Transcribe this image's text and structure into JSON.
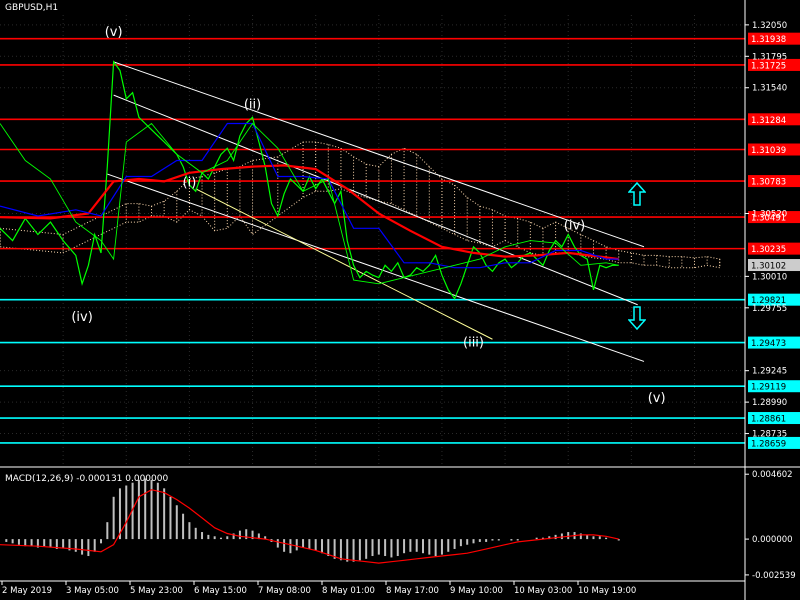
{
  "header": {
    "symbol": "GBPUSD,H1",
    "macd_label": "MACD(12,26,9) -0.000131 0.000000"
  },
  "colors": {
    "background": "#000000",
    "price_line": "#00ff00",
    "ma_red": "#ff0000",
    "ma_blue": "#0000ff",
    "resistance": "#ff0000",
    "support": "#00ffff",
    "channel": "#ffffff",
    "channel_yellow": "#ffff99",
    "cloud": "#ffdab0",
    "macd_hist": "#c0c0c0",
    "signal": "#ff0000",
    "arrows": "#00ffff",
    "current_price_box": "#cccccc"
  },
  "icons": {
    "up": "up-arrow-icon",
    "down": "down-arrow-icon"
  },
  "chart_data": {
    "type": "line",
    "title": "GBPUSD,H1",
    "ylim": [
      1.2848,
      1.3213
    ],
    "y_ticks": [
      "1.32050",
      "1.31795",
      "1.31540",
      "1.30520",
      "1.30010",
      "1.29755",
      "1.29245",
      "1.28990",
      "1.28735"
    ],
    "x_ticks": [
      "2 May 2019",
      "3 May 05:00",
      "5 May 23:00",
      "6 May 15:00",
      "7 May 08:00",
      "8 May 01:00",
      "8 May 17:00",
      "9 May 10:00",
      "10 May 03:00",
      "10 May 19:00"
    ],
    "current_price": "1.30102",
    "resistance_levels": [
      {
        "value": 1.31938,
        "label": "1.31938"
      },
      {
        "value": 1.31725,
        "label": "1.31725"
      },
      {
        "value": 1.31284,
        "label": "1.31284"
      },
      {
        "value": 1.31039,
        "label": "1.31039"
      },
      {
        "value": 1.30783,
        "label": "1.30783"
      },
      {
        "value": 1.30491,
        "label": "1.30491"
      },
      {
        "value": 1.30235,
        "label": "1.30235"
      }
    ],
    "support_levels": [
      {
        "value": 1.29821,
        "label": "1.29821"
      },
      {
        "value": 1.29473,
        "label": "1.29473"
      },
      {
        "value": 1.29119,
        "label": "1.29119"
      },
      {
        "value": 1.28861,
        "label": "1.28861"
      },
      {
        "value": 1.28659,
        "label": "1.28659"
      }
    ],
    "wave_labels": [
      {
        "label": "(v)",
        "x": 18,
        "y": 1.3196
      },
      {
        "label": "(iv)",
        "x": 13,
        "y": 1.2965
      },
      {
        "label": "(ii)",
        "x": 40,
        "y": 1.3137
      },
      {
        "label": "(i)",
        "x": 30,
        "y": 1.3074
      },
      {
        "label": "(iii)",
        "x": 75,
        "y": 1.2944
      },
      {
        "label": "(iv)",
        "x": 91,
        "y": 1.3039
      },
      {
        "label": "(v)",
        "x": 104,
        "y": 1.2899
      }
    ],
    "channels": [
      {
        "color": "white",
        "points": [
          [
            18,
            1.3175
          ],
          [
            102,
            1.3025
          ]
        ]
      },
      {
        "color": "white",
        "points": [
          [
            18,
            1.3148
          ],
          [
            101,
            1.2978
          ]
        ]
      },
      {
        "color": "white",
        "points": [
          [
            17,
            1.3084
          ],
          [
            102,
            1.2932
          ]
        ]
      },
      {
        "color": "yellow",
        "points": [
          [
            31,
            1.3072
          ],
          [
            78,
            1.295
          ]
        ]
      }
    ],
    "series": [
      {
        "name": "",
        "x": [
          0,
          2,
          4,
          6,
          8,
          10,
          12,
          13,
          14,
          15,
          16,
          17,
          18,
          19,
          20,
          21,
          22,
          23,
          24,
          25,
          26,
          27,
          28,
          29,
          30,
          31,
          32,
          33,
          34,
          35,
          36,
          37,
          38,
          39,
          40,
          41,
          42,
          43,
          44,
          45,
          46,
          47,
          48,
          49,
          50,
          51,
          52,
          53,
          54,
          55,
          56,
          57,
          58,
          59,
          60,
          61,
          62,
          63,
          64,
          65,
          66,
          67,
          68,
          69,
          70,
          71,
          72,
          73,
          74,
          75,
          76,
          77,
          78,
          79,
          80,
          81,
          82,
          83,
          84,
          85,
          86,
          87,
          88,
          89,
          90,
          91,
          92,
          93,
          94,
          95,
          96,
          97,
          98
        ],
        "y": [
          1.304,
          1.303,
          1.3048,
          1.3035,
          1.3045,
          1.303,
          1.3018,
          1.2995,
          1.301,
          1.3035,
          1.302,
          1.309,
          1.3175,
          1.3168,
          1.3145,
          1.315,
          1.313,
          1.3125,
          1.312,
          1.3115,
          1.311,
          1.3105,
          1.31,
          1.309,
          1.3075,
          1.307,
          1.3085,
          1.308,
          1.309,
          1.31,
          1.3105,
          1.3095,
          1.3115,
          1.3125,
          1.313,
          1.311,
          1.309,
          1.306,
          1.305,
          1.3068,
          1.308,
          1.3075,
          1.307,
          1.3082,
          1.3072,
          1.308,
          1.307,
          1.306,
          1.307,
          1.303,
          1.301,
          1.3,
          1.3005,
          1.3002,
          1.3,
          1.301,
          1.3005,
          1.3012,
          1.3,
          1.3002,
          1.3008,
          1.3005,
          1.301,
          1.3018,
          1.3002,
          1.299,
          1.2983,
          1.2995,
          1.301,
          1.3025,
          1.302,
          1.301,
          1.3005,
          1.3012,
          1.3015,
          1.3008,
          1.3012,
          1.3018,
          1.302,
          1.3015,
          1.301,
          1.3022,
          1.303,
          1.3025,
          1.3035,
          1.3025,
          1.3018,
          1.3015,
          1.299,
          1.301,
          1.3008,
          1.301,
          1.301
        ]
      },
      {
        "name": "",
        "x": [
          0,
          8,
          14,
          18,
          22,
          26,
          30,
          35,
          40,
          45,
          50,
          55,
          60,
          65,
          70,
          75,
          80,
          85,
          90,
          95,
          98
        ],
        "y": [
          1.3049,
          1.3048,
          1.3052,
          1.3078,
          1.308,
          1.3078,
          1.3085,
          1.3088,
          1.309,
          1.3091,
          1.3088,
          1.3072,
          1.3052,
          1.3038,
          1.3025,
          1.302,
          1.3017,
          1.3018,
          1.302,
          1.3017,
          1.3015
        ]
      },
      {
        "name": "",
        "x": [
          0,
          6,
          12,
          16,
          20,
          24,
          28,
          32,
          36,
          40,
          44,
          48,
          52,
          56,
          60,
          64,
          68,
          72,
          76,
          80,
          84,
          88,
          92,
          96,
          98
        ],
        "y": [
          1.3058,
          1.305,
          1.3055,
          1.305,
          1.3082,
          1.3082,
          1.3095,
          1.3095,
          1.3125,
          1.3125,
          1.3082,
          1.3082,
          1.308,
          1.304,
          1.304,
          1.3012,
          1.3012,
          1.3008,
          1.3008,
          1.3012,
          1.3012,
          1.3022,
          1.3022,
          1.3015,
          1.3015
        ]
      },
      {
        "name": "",
        "x": [
          0,
          4,
          8,
          12,
          16,
          18,
          20,
          24,
          28,
          32,
          36,
          40,
          44,
          48,
          52,
          56,
          60,
          64,
          68,
          72,
          76,
          80,
          84,
          88,
          92,
          96,
          98
        ],
        "y": [
          1.3125,
          1.3095,
          1.308,
          1.3045,
          1.303,
          1.3015,
          1.311,
          1.3125,
          1.31,
          1.3085,
          1.3095,
          1.3125,
          1.3105,
          1.307,
          1.308,
          1.2998,
          1.2995,
          1.3,
          1.3005,
          1.301,
          1.3015,
          1.3025,
          1.303,
          1.3028,
          1.301,
          1.3012,
          1.301
        ]
      }
    ],
    "cloud": {
      "x": [
        0,
        10,
        20,
        22,
        24,
        26,
        28,
        30,
        32,
        34,
        36,
        38,
        40,
        44,
        48,
        50,
        52,
        54,
        56,
        58,
        60,
        62,
        64,
        66,
        68,
        70,
        72,
        74,
        76,
        78,
        80,
        82,
        84,
        86,
        88,
        90,
        92,
        94,
        96,
        98,
        100,
        102,
        104,
        106,
        108,
        110,
        112,
        114
      ],
      "upper": [
        1.304,
        1.3035,
        1.306,
        1.306,
        1.3058,
        1.3062,
        1.307,
        1.308,
        1.3082,
        1.3085,
        1.3088,
        1.309,
        1.3095,
        1.3098,
        1.311,
        1.311,
        1.3108,
        1.3105,
        1.3098,
        1.3092,
        1.309,
        1.31,
        1.3105,
        1.31,
        1.309,
        1.308,
        1.3075,
        1.3065,
        1.3058,
        1.3055,
        1.305,
        1.3048,
        1.3045,
        1.304,
        1.3045,
        1.304,
        1.3035,
        1.303,
        1.3025,
        1.3022,
        1.302,
        1.3018,
        1.3018,
        1.3017,
        1.3017,
        1.3016,
        1.3017,
        1.3015
      ],
      "lower": [
        1.3025,
        1.302,
        1.3045,
        1.3045,
        1.305,
        1.305,
        1.3045,
        1.3055,
        1.305,
        1.3038,
        1.304,
        1.305,
        1.3035,
        1.305,
        1.3065,
        1.307,
        1.307,
        1.3072,
        1.3068,
        1.3065,
        1.3062,
        1.306,
        1.3055,
        1.305,
        1.3045,
        1.304,
        1.3035,
        1.303,
        1.3028,
        1.3025,
        1.303,
        1.3025,
        1.302,
        1.3018,
        1.302,
        1.302,
        1.3018,
        1.3016,
        1.3015,
        1.3012,
        1.3012,
        1.301,
        1.301,
        1.3008,
        1.3008,
        1.3008,
        1.301,
        1.3008
      ]
    },
    "macd": {
      "y_ticks": [
        "0.004602",
        "0.000000",
        "-0.002539"
      ],
      "ylim": [
        -0.0029,
        0.0049
      ],
      "histogram": {
        "x": [
          0,
          1,
          2,
          3,
          4,
          5,
          6,
          7,
          8,
          9,
          10,
          11,
          12,
          13,
          14,
          15,
          16,
          17,
          18,
          19,
          20,
          21,
          22,
          23,
          24,
          25,
          26,
          27,
          28,
          29,
          30,
          31,
          32,
          33,
          34,
          35,
          36,
          37,
          38,
          39,
          40,
          41,
          42,
          43,
          44,
          45,
          46,
          47,
          48,
          49,
          50,
          51,
          52,
          53,
          54,
          55,
          56,
          57,
          58,
          59,
          60,
          61,
          62,
          63,
          64,
          65,
          66,
          67,
          68,
          69,
          70,
          71,
          72,
          73,
          74,
          75,
          76,
          77,
          78,
          79,
          80,
          81,
          82,
          83,
          84,
          85,
          86,
          87,
          88,
          89,
          90,
          91,
          92,
          93,
          94,
          95,
          96,
          97,
          98
        ],
        "values": [
          0.0,
          -0.0002,
          -0.0003,
          -0.0004,
          -0.0005,
          -0.0005,
          -0.0006,
          -0.0005,
          -0.0006,
          -0.0007,
          -0.0006,
          -0.0008,
          -0.0009,
          -0.0011,
          -0.0012,
          -0.0009,
          -0.0003,
          0.0012,
          0.003,
          0.0036,
          0.0038,
          0.004,
          0.0042,
          0.0043,
          0.0042,
          0.004,
          0.0036,
          0.003,
          0.0024,
          0.0018,
          0.0012,
          0.0008,
          0.0005,
          0.0003,
          0.0002,
          0.0001,
          0.0002,
          0.0004,
          0.0006,
          0.0007,
          0.0006,
          0.0004,
          0.0002,
          -0.0002,
          -0.0006,
          -0.0009,
          -0.001,
          -0.0008,
          -0.0006,
          -0.0007,
          -0.0008,
          -0.001,
          -0.0012,
          -0.0014,
          -0.0015,
          -0.0016,
          -0.0016,
          -0.0015,
          -0.0014,
          -0.0012,
          -0.0011,
          -0.0012,
          -0.0013,
          -0.0012,
          -0.001,
          -0.0009,
          -0.0009,
          -0.001,
          -0.0011,
          -0.0012,
          -0.0011,
          -0.0009,
          -0.0007,
          -0.0005,
          -0.0004,
          -0.0003,
          -0.0002,
          -0.0002,
          -0.0001,
          -0.0001,
          0.0,
          -0.0001,
          -0.0001,
          0.0,
          0.0,
          0.0001,
          0.0001,
          0.0002,
          0.0003,
          0.0004,
          0.0005,
          0.0005,
          0.0004,
          0.0003,
          0.0002,
          0.0002,
          0.0001,
          0.0,
          -0.0001
        ]
      },
      "signal": {
        "x": [
          0,
          6,
          12,
          14,
          16,
          18,
          20,
          22,
          24,
          26,
          28,
          30,
          32,
          34,
          36,
          38,
          40,
          42,
          44,
          46,
          48,
          50,
          52,
          54,
          56,
          58,
          60,
          62,
          64,
          66,
          68,
          70,
          72,
          74,
          76,
          78,
          80,
          82,
          84,
          86,
          88,
          90,
          92,
          94,
          96,
          98
        ],
        "y": [
          -0.0004,
          -0.0005,
          -0.0007,
          -0.0008,
          -0.0009,
          -0.0004,
          0.0012,
          0.003,
          0.0035,
          0.0033,
          0.0028,
          0.0022,
          0.0015,
          0.0008,
          0.0004,
          0.0002,
          0.0001,
          0.0,
          -0.0002,
          -0.0004,
          -0.0006,
          -0.0008,
          -0.0011,
          -0.0014,
          -0.0015,
          -0.0016,
          -0.0017,
          -0.0016,
          -0.0015,
          -0.0014,
          -0.0013,
          -0.0012,
          -0.0011,
          -0.001,
          -0.0008,
          -0.0006,
          -0.0004,
          -0.0002,
          -0.0001,
          0.0,
          0.0001,
          0.0002,
          0.0003,
          0.0003,
          0.0002,
          0.0
        ]
      }
    }
  }
}
